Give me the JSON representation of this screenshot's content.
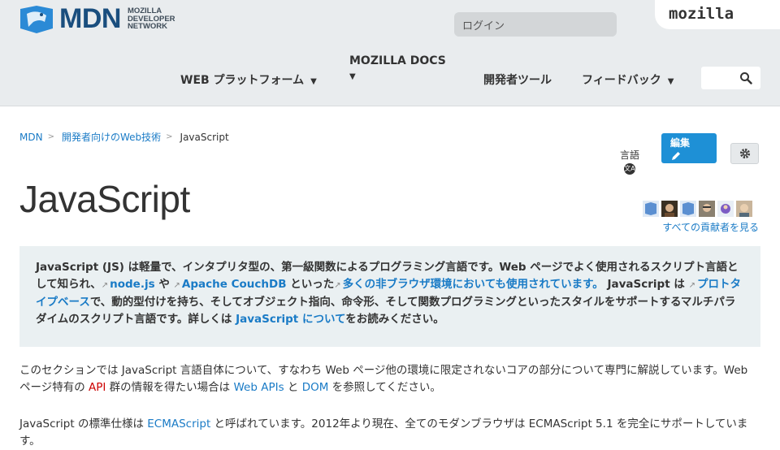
{
  "header": {
    "logo_text": "MDN",
    "logo_sub": [
      "MOZILLA",
      "DEVELOPER",
      "NETWORK"
    ],
    "login_label": "ログイン",
    "mozilla_tab": "mozilla",
    "nav": {
      "web_platform": "WEB プラットフォーム",
      "mozilla_docs": "MOZILLA DOCS",
      "dev_tools": "開発者ツール",
      "feedback": "フィードバック"
    }
  },
  "breadcrumb": {
    "items": [
      "MDN",
      "開発者向けのWeb技術"
    ],
    "current": "JavaScript"
  },
  "toolbar": {
    "language_label": "言語",
    "edit_label": "編集"
  },
  "page": {
    "title": "JavaScript",
    "contributors_link": "すべての貢献者を見る"
  },
  "summary": {
    "t1": "JavaScript (JS) は軽量で、インタプリタ型の、第一級関数によるプログラミング言語です。Web ページでよく使用されるスクリプト言語として知られ、",
    "link_node": "node.js",
    "t2": " や ",
    "link_couch": "Apache CouchDB",
    "t3": " といった",
    "link_nonbrowser": "多くの非ブラウザ環境においても使用されています。",
    "t4": " JavaScript は ",
    "link_proto": "プロトタイプベース",
    "t5": "で、動的型付けを持ち、そしてオブジェクト指向、命令形、そして関数プログラミングといったスタイルをサポートするマルチパラダイムのスクリプト言語です。詳しくは ",
    "link_about": "JavaScript について",
    "t6": "をお読みください。"
  },
  "body": {
    "p1_a": "このセクションでは JavaScript 言語自体について、すなわち Web ページ他の環境に限定されないコアの部分について専門に解説しています。Web ページ特有の ",
    "p1_api": "API",
    "p1_b": " 群の情報を得たい場合は ",
    "p1_webapis": "Web APIs",
    "p1_c": " と ",
    "p1_dom": "DOM",
    "p1_d": " を参照してください。",
    "p2_a": "JavaScript の標準仕様は ",
    "p2_ecma": "ECMAScript",
    "p2_b": " と呼ばれています。2012年より現在、全てのモダンブラウザは ECMAScript 5.1 を完全にサポートしています。"
  },
  "colors": {
    "link": "#1a7bc6",
    "edit_button": "#1e90d6",
    "header_bg": "#e9ecee",
    "summary_bg": "#eaf0f2"
  }
}
